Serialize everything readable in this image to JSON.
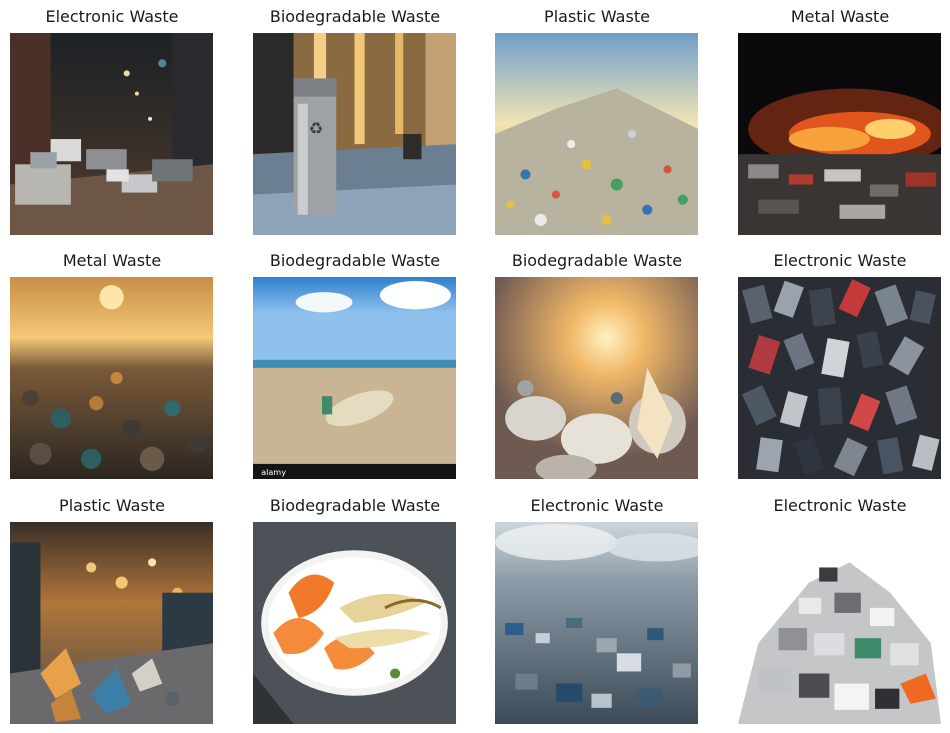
{
  "figure": {
    "panels": [
      {
        "title": "Electronic Waste",
        "scene": "ewaste-alley"
      },
      {
        "title": "Biodegradable Waste",
        "scene": "recycle-bin"
      },
      {
        "title": "Plastic Waste",
        "scene": "plastic-mountain"
      },
      {
        "title": "Metal Waste",
        "scene": "metal-fire"
      },
      {
        "title": "Metal Waste",
        "scene": "metal-sunset"
      },
      {
        "title": "Biodegradable Waste",
        "scene": "beach-bottle"
      },
      {
        "title": "Biodegradable Waste",
        "scene": "plastic-sunset"
      },
      {
        "title": "Electronic Waste",
        "scene": "phones-pile"
      },
      {
        "title": "Plastic Waste",
        "scene": "street-trash"
      },
      {
        "title": "Biodegradable Waste",
        "scene": "peel-plate"
      },
      {
        "title": "Electronic Waste",
        "scene": "ewaste-field"
      },
      {
        "title": "Electronic Waste",
        "scene": "ewaste-heap"
      }
    ],
    "watermark": "alamy"
  }
}
